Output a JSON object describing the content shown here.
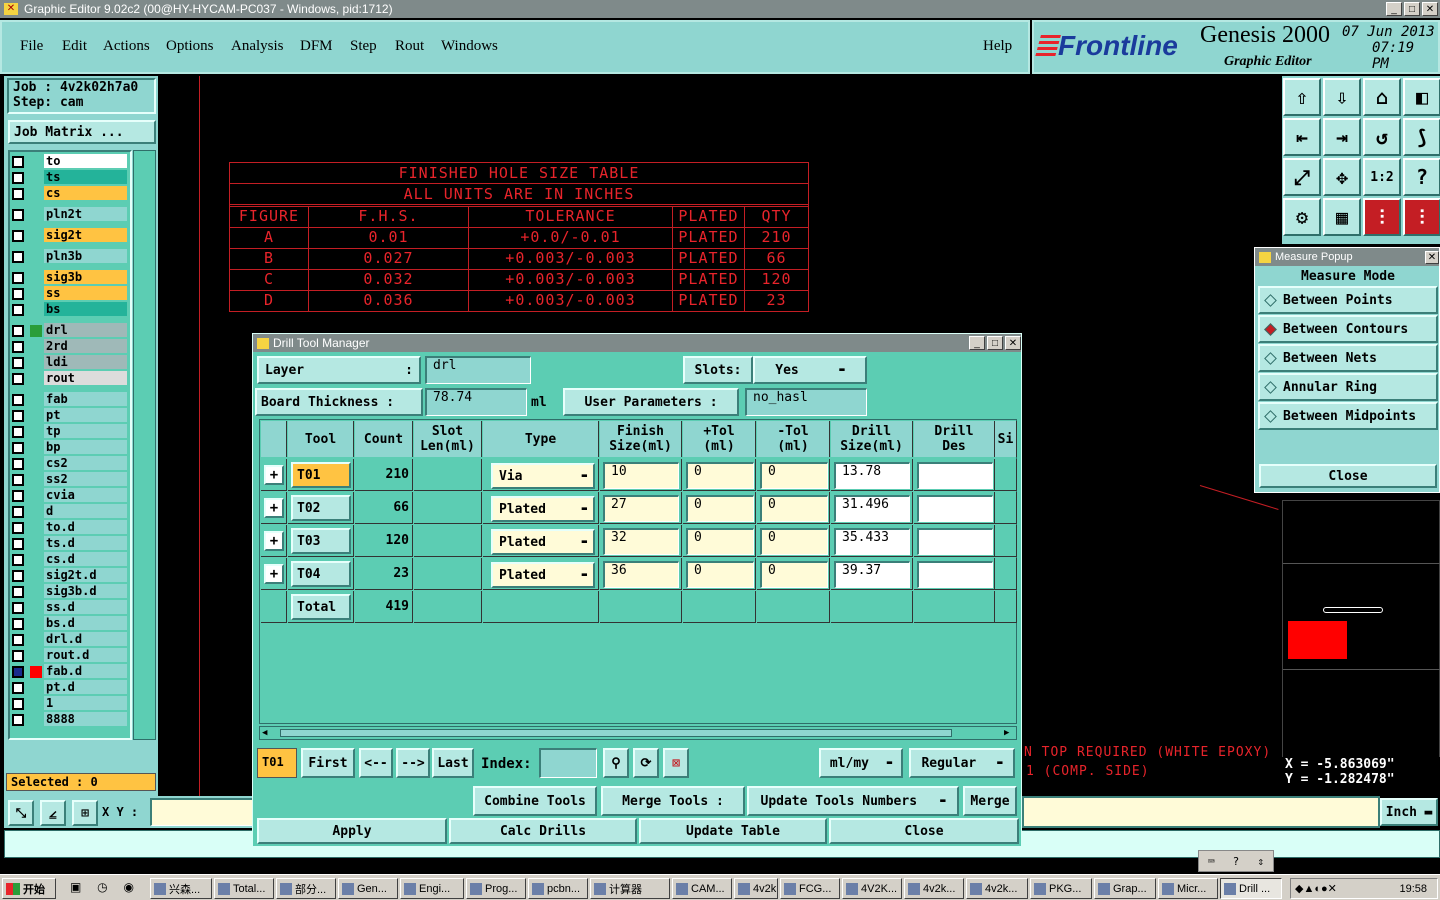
{
  "window": {
    "title": "Graphic Editor 9.02c2 (00@HY-HYCAM-PC037 - Windows, pid:1712)"
  },
  "menu": [
    "File",
    "Edit",
    "Actions",
    "Options",
    "Analysis",
    "DFM",
    "Step",
    "Rout",
    "Windows"
  ],
  "help": "Help",
  "brand": {
    "logo": "Frontline",
    "product": "Genesis 2000",
    "subtitle": "Graphic Editor",
    "date": "07 Jun 2013",
    "time": "07:19 PM"
  },
  "job": {
    "job": "Job  : 4v2k02h7a0",
    "step": "Step: cam",
    "matrix": "Job Matrix ..."
  },
  "layers": [
    {
      "name": "to",
      "color": "#ffffff"
    },
    {
      "name": "ts",
      "color": "#24b39a"
    },
    {
      "name": "cs",
      "color": "#ffc342"
    },
    {
      "name": "pln2t",
      "color": "#8fd6d0"
    },
    {
      "name": "sig2t",
      "color": "#ffc342"
    },
    {
      "name": "pln3b",
      "color": "#8fd6d0"
    },
    {
      "name": "sig3b",
      "color": "#ffc342"
    },
    {
      "name": "ss",
      "color": "#ffc342"
    },
    {
      "name": "bs",
      "color": "#24b39a"
    },
    {
      "name": "drl",
      "color": "#9fb9b8"
    },
    {
      "name": "2rd",
      "color": "#9fb9b8"
    },
    {
      "name": "ldi",
      "color": "#9fb9b8"
    },
    {
      "name": "rout",
      "color": "#dcdcdc"
    },
    {
      "name": "fab",
      "color": "#8fd6d0"
    },
    {
      "name": "pt",
      "color": "#8fd6d0"
    },
    {
      "name": "tp",
      "color": "#8fd6d0"
    },
    {
      "name": "bp",
      "color": "#8fd6d0"
    },
    {
      "name": "cs2",
      "color": "#8fd6d0"
    },
    {
      "name": "ss2",
      "color": "#8fd6d0"
    },
    {
      "name": "cvia",
      "color": "#8fd6d0"
    },
    {
      "name": "d",
      "color": "#8fd6d0"
    },
    {
      "name": "to.d",
      "color": "#8fd6d0"
    },
    {
      "name": "ts.d",
      "color": "#8fd6d0"
    },
    {
      "name": "cs.d",
      "color": "#8fd6d0"
    },
    {
      "name": "sig2t.d",
      "color": "#8fd6d0"
    },
    {
      "name": "sig3b.d",
      "color": "#8fd6d0"
    },
    {
      "name": "ss.d",
      "color": "#8fd6d0"
    },
    {
      "name": "bs.d",
      "color": "#8fd6d0"
    },
    {
      "name": "drl.d",
      "color": "#8fd6d0"
    },
    {
      "name": "rout.d",
      "color": "#8fd6d0"
    },
    {
      "name": "fab.d",
      "color": "#8fd6d0"
    },
    {
      "name": "pt.d",
      "color": "#8fd6d0"
    },
    {
      "name": "1",
      "color": "#8fd6d0"
    },
    {
      "name": "8888",
      "color": "#8fd6d0"
    }
  ],
  "selected": "Selected : 0",
  "xy_label": "X Y :",
  "hole_table": {
    "title": "FINISHED HOLE SIZE TABLE",
    "subtitle": "ALL UNITS ARE IN INCHES",
    "headers": [
      "FIGURE",
      "F.H.S.",
      "TOLERANCE",
      "PLATED",
      "QTY"
    ],
    "rows": [
      [
        "A",
        "0.01",
        "+0.0/-0.01",
        "PLATED",
        "210"
      ],
      [
        "B",
        "0.027",
        "+0.003/-0.003",
        "PLATED",
        "66"
      ],
      [
        "C",
        "0.032",
        "+0.003/-0.003",
        "PLATED",
        "120"
      ],
      [
        "D",
        "0.036",
        "+0.003/-0.003",
        "PLATED",
        "23"
      ]
    ]
  },
  "canvas_notes": [
    "N TOP REQUIRED (WHITE EPOXY)",
    "1 (COMP. SIDE)"
  ],
  "dtm": {
    "title": "Drill Tool Manager",
    "layer_label": "Layer",
    "layer_colon": ":",
    "layer_value": "drl",
    "slots_label": "Slots:",
    "slots_value": "Yes",
    "thickness_label": "Board Thickness :",
    "thickness_value": "78.74",
    "thickness_unit": "ml",
    "user_params_label": "User Parameters :",
    "user_params_value": "no_hasl",
    "headers": [
      "Tool",
      "Count",
      "Slot\nLen(ml)",
      "Type",
      "Finish\nSize(ml)",
      "+Tol\n(ml)",
      "-Tol\n(ml)",
      "Drill\nSize(ml)",
      "Drill\nDes",
      "Si"
    ],
    "rows": [
      {
        "tool": "T01",
        "count": "210",
        "type": "Via",
        "finish": "10",
        "ptol": "0",
        "mtol": "0",
        "drill": "13.78"
      },
      {
        "tool": "T02",
        "count": "66",
        "type": "Plated",
        "finish": "27",
        "ptol": "0",
        "mtol": "0",
        "drill": "31.496"
      },
      {
        "tool": "T03",
        "count": "120",
        "type": "Plated",
        "finish": "32",
        "ptol": "0",
        "mtol": "0",
        "drill": "35.433"
      },
      {
        "tool": "T04",
        "count": "23",
        "type": "Plated",
        "finish": "36",
        "ptol": "0",
        "mtol": "0",
        "drill": "39.37"
      }
    ],
    "total_label": "Total",
    "total_value": "419",
    "current": "T01",
    "nav": {
      "first": "First",
      "prev": "<--",
      "next": "-->",
      "last": "Last",
      "index": "Index:"
    },
    "units": "ml/my",
    "mode": "Regular",
    "buttons": {
      "combine": "Combine Tools",
      "merge_tools": "Merge Tools :",
      "update_numbers": "Update Tools Numbers",
      "merge": "Merge",
      "apply": "Apply",
      "calc": "Calc Drills",
      "update_table": "Update Table",
      "close": "Close"
    }
  },
  "measure": {
    "title": "Measure Popup",
    "mode_label": "Measure Mode",
    "options": [
      "Between Points",
      "Between Contours",
      "Between Nets",
      "Annular Ring",
      "Between Midpoints"
    ],
    "selected": "Between Contours",
    "close": "Close"
  },
  "coords": {
    "x": "X = -5.863069\"",
    "y": "Y = -1.282478\""
  },
  "units_button": "Inch",
  "taskbar": {
    "start": "开始",
    "tasks": [
      "兴森...",
      "Total...",
      "部分...",
      "Gen...",
      "Engi...",
      "Prog...",
      "pcbn...",
      "计算器",
      "CAM...",
      "4v2k...",
      "FCG...",
      "4V2K...",
      "4v2k...",
      "4v2k...",
      "PKG...",
      "Grap...",
      "Micr...",
      "Drill ..."
    ],
    "clock": "19:58"
  }
}
